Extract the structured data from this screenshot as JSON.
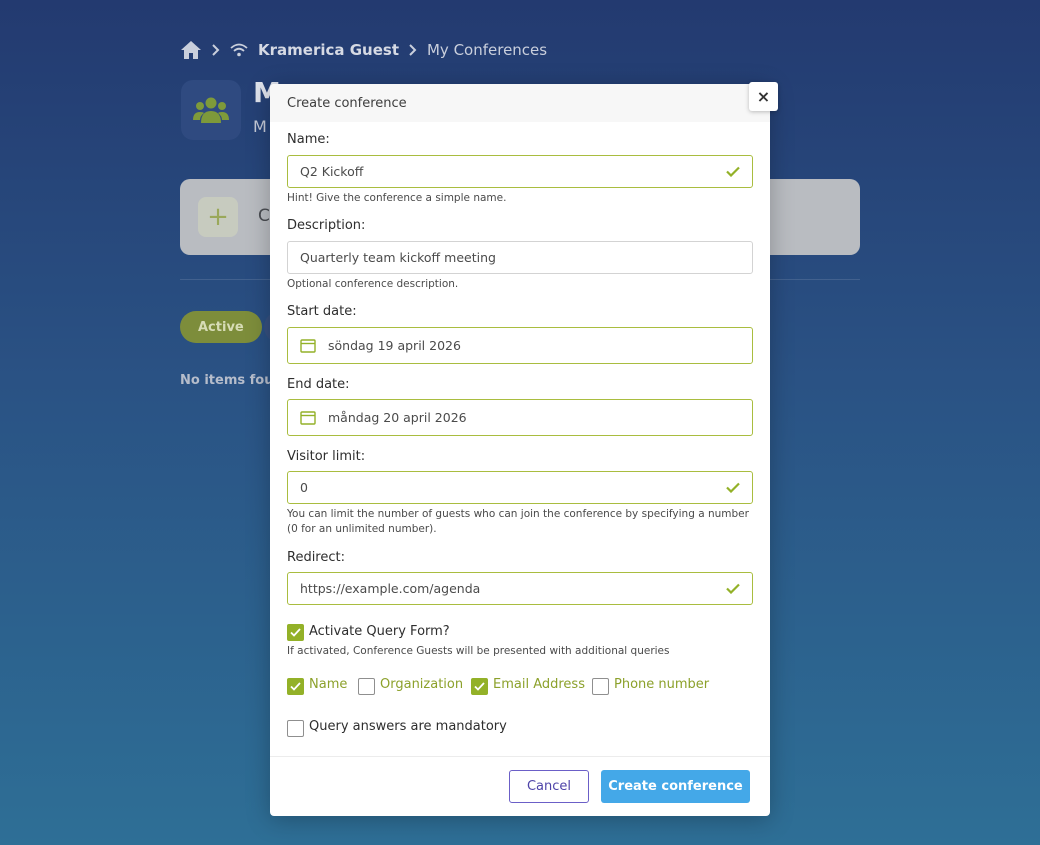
{
  "breadcrumb": {
    "network": "Kramerica Guest",
    "current": "My Conferences"
  },
  "page": {
    "title": "M",
    "subtitle": "M",
    "create_card_label": "C",
    "filter_active": "Active",
    "empty_text": "No items four"
  },
  "modal": {
    "title": "Create conference",
    "close_symbol": "×",
    "name": {
      "label": "Name:",
      "value": "Q2 Kickoff",
      "hint": "Hint! Give the conference a simple name."
    },
    "description": {
      "label": "Description:",
      "value": "Quarterly team kickoff meeting",
      "hint": "Optional conference description."
    },
    "start_date": {
      "label": "Start date:",
      "value": "söndag 19 april 2026"
    },
    "end_date": {
      "label": "End date:",
      "value": "måndag 20 april 2026"
    },
    "visitor_limit": {
      "label": "Visitor limit:",
      "value": "0",
      "hint": "You can limit the number of guests who can join the conference by specifying a number (0 for an unlimited number)."
    },
    "redirect": {
      "label": "Redirect:",
      "value": "https://example.com/agenda"
    },
    "query_form": {
      "label": "Activate Query Form?",
      "checked": true,
      "hint": "If activated, Conference Guests will be presented with additional queries",
      "options": [
        {
          "label": "Name",
          "checked": true
        },
        {
          "label": "Organization",
          "checked": false
        },
        {
          "label": "Email Address",
          "checked": true
        },
        {
          "label": "Phone number",
          "checked": false
        }
      ]
    },
    "mandatory": {
      "label": "Query answers are mandatory",
      "checked": false
    },
    "buttons": {
      "cancel": "Cancel",
      "create": "Create conference"
    }
  },
  "colors": {
    "accent_green": "#93b128",
    "primary_blue": "#44a8e8",
    "cancel_purple": "#6b5fc7"
  }
}
